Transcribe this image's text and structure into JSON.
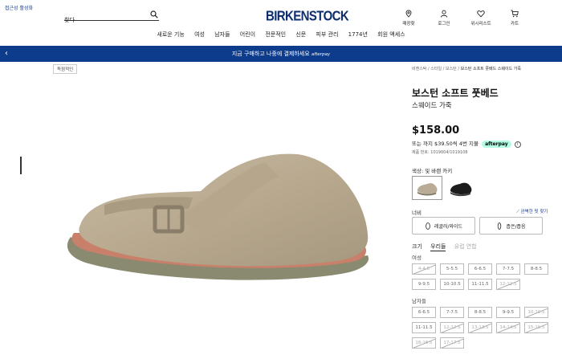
{
  "header": {
    "skip_link": "접근성 활성화",
    "search_placeholder": "찾다",
    "logo": "BIRKENSTOCK",
    "utils": [
      {
        "label": "매장찾",
        "icon": "location-pin-icon"
      },
      {
        "label": "로그인",
        "icon": "user-icon"
      },
      {
        "label": "위시리스트",
        "icon": "heart-icon"
      },
      {
        "label": "카트",
        "icon": "cart-icon"
      }
    ]
  },
  "nav": [
    "새로운 기능",
    "여성",
    "남자들",
    "어린이",
    "전문적인",
    "신문",
    "피부 관리",
    "1774년",
    "회원 액세스"
  ],
  "banner": {
    "text": "지금 구매하고 나중에 결제하세요",
    "brand": "afterpay"
  },
  "badge": "독점적인",
  "breadcrumb": {
    "prefix": "비켄스탁 / 스타일 / 보스턴 / ",
    "current": "보스턴 소프트 풋베드 스웨이드 가죽"
  },
  "product": {
    "title": "보스턴 소프트 풋베드",
    "subtitle": "스웨이드 가죽",
    "price": "$158.00",
    "installment_text": "또는 까지 $39.50씩 4번 지불",
    "afterpay_label": "afterpay",
    "part_number": "제품 번호: 1019004/1019108",
    "color_label": "색상: 및 바랜 카키",
    "colors": [
      {
        "name": "faded-khaki",
        "hex": "#b9ab95",
        "selected": true
      },
      {
        "name": "black",
        "hex": "#1c1c1c",
        "selected": false
      }
    ]
  },
  "width": {
    "label": "너비",
    "fit_link": "완벽한 핏 찾기",
    "options": [
      "레귤러/와이드",
      "좁은/좁음"
    ]
  },
  "size_tabs": {
    "tab1": "크기",
    "tab2": "우리들",
    "tab3": "유럽 연합"
  },
  "sizes": {
    "women_label": "여성",
    "women": [
      {
        "v": "4-4.5",
        "na": true
      },
      {
        "v": "5-5.5",
        "na": false
      },
      {
        "v": "6-6.5",
        "na": false
      },
      {
        "v": "7-7.5",
        "na": false
      },
      {
        "v": "8-8.5",
        "na": false
      },
      {
        "v": "9-9.5",
        "na": false
      },
      {
        "v": "10-10.5",
        "na": false
      },
      {
        "v": "11-11.5",
        "na": false
      },
      {
        "v": "12-12.5",
        "na": true
      }
    ],
    "men_label": "남자들",
    "men": [
      {
        "v": "6-6.5",
        "na": false
      },
      {
        "v": "7-7.5",
        "na": false
      },
      {
        "v": "8-8.5",
        "na": false
      },
      {
        "v": "9-9.5",
        "na": false
      },
      {
        "v": "10-10.5",
        "na": true
      },
      {
        "v": "11-11.5",
        "na": false
      },
      {
        "v": "12-12.5",
        "na": true
      },
      {
        "v": "13-13.5",
        "na": true
      },
      {
        "v": "14-14.5",
        "na": true
      },
      {
        "v": "15-15.5",
        "na": true
      },
      {
        "v": "16-16.5",
        "na": true
      },
      {
        "v": "17-17.5",
        "na": true
      }
    ]
  }
}
